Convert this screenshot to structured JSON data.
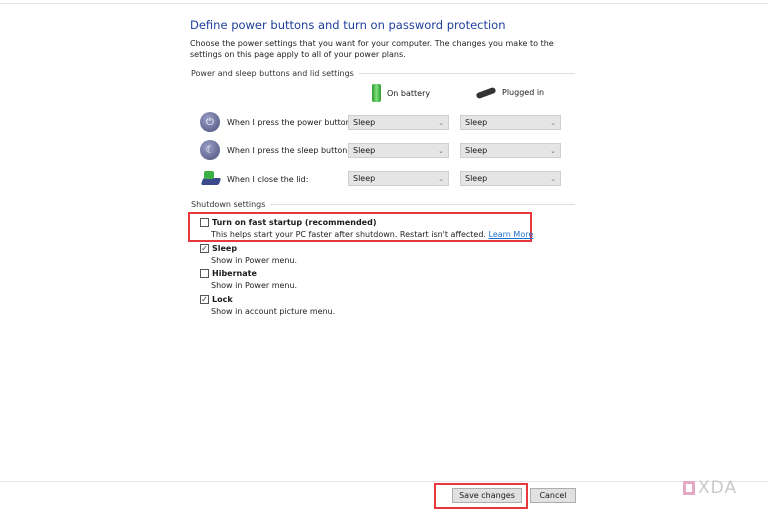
{
  "title": "Define power buttons and turn on password protection",
  "description": "Choose the power settings that you want for your computer. The changes you make to the settings on this page apply to all of your power plans.",
  "buttons_group": {
    "label": "Power and sleep buttons and lid settings",
    "columns": {
      "battery": "On battery",
      "plugged": "Plugged in"
    },
    "rows": [
      {
        "label": "When I press the power button:",
        "battery": "Sleep",
        "plugged": "Sleep"
      },
      {
        "label": "When I press the sleep button:",
        "battery": "Sleep",
        "plugged": "Sleep"
      },
      {
        "label": "When I close the lid:",
        "battery": "Sleep",
        "plugged": "Sleep"
      }
    ]
  },
  "shutdown": {
    "label": "Shutdown settings",
    "fast_startup": {
      "label": "Turn on fast startup (recommended)",
      "desc": "This helps start your PC faster after shutdown. Restart isn't affected.",
      "link": "Learn More",
      "checked": false
    },
    "sleep": {
      "label": "Sleep",
      "desc": "Show in Power menu.",
      "checked": true
    },
    "hibernate": {
      "label": "Hibernate",
      "desc": "Show in Power menu.",
      "checked": false
    },
    "lock": {
      "label": "Lock",
      "desc": "Show in account picture menu.",
      "checked": true
    }
  },
  "footer": {
    "save": "Save changes",
    "cancel": "Cancel"
  },
  "watermark": "XDA",
  "colors": {
    "highlight": "#e8383f",
    "title": "#1e3f9a",
    "link": "#1a6fd1"
  }
}
